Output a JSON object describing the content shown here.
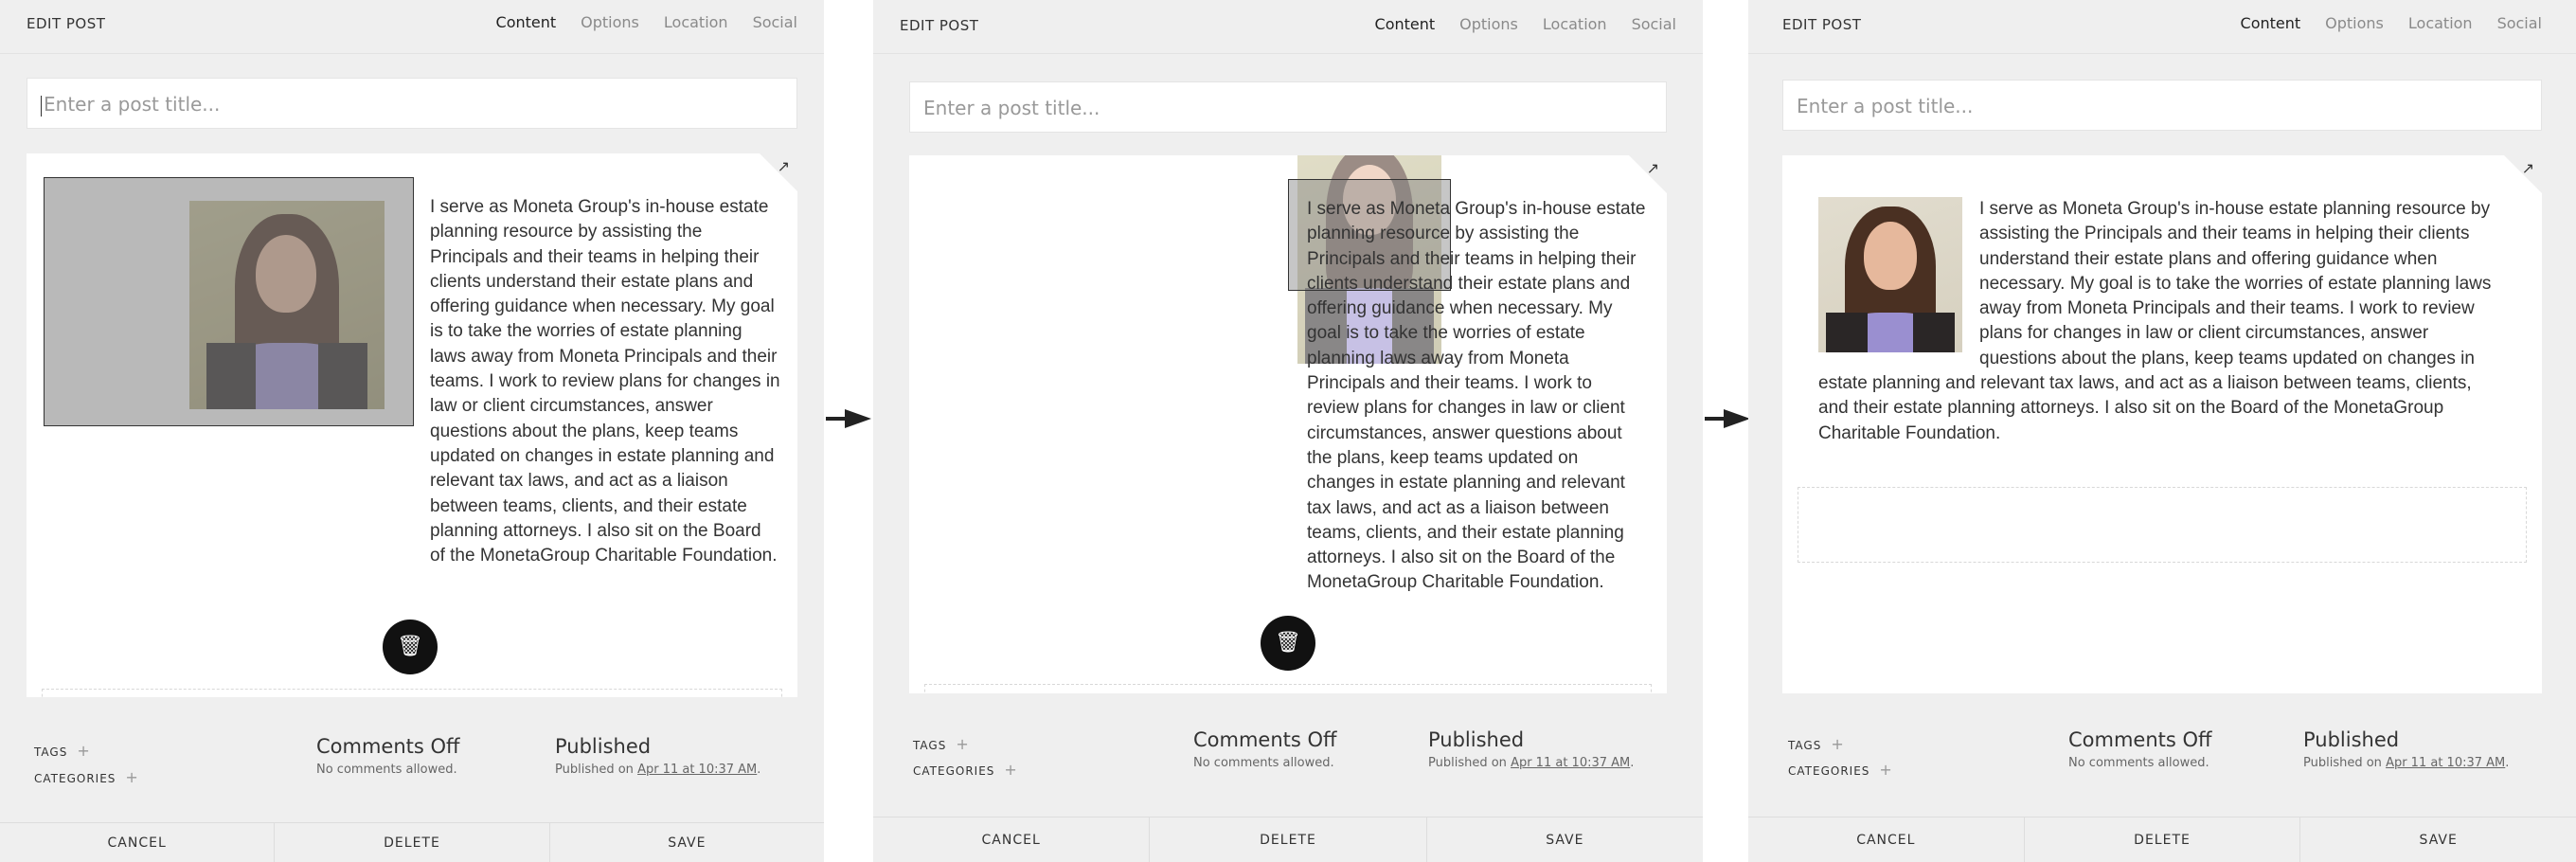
{
  "header": {
    "title": "EDIT POST",
    "tabs": [
      "Content",
      "Options",
      "Location",
      "Social"
    ]
  },
  "post": {
    "title_placeholder": "Enter a post title...",
    "body": "I serve as Moneta Group's in-house estate planning resource by assisting the Principals and their teams in helping their clients understand their estate plans and offering guidance when necessary. My goal is to take the worries of estate planning laws away from Moneta Principals and their teams. I work to review plans for changes in law or client circumstances, answer questions about the plans, keep teams updated on changes in estate planning and relevant tax laws, and act as a liaison between teams, clients, and their estate planning attorneys. I also sit on the Board of the MonetaGroup Charitable Foundation."
  },
  "meta": {
    "tags_label": "TAGS",
    "categories_label": "CATEGORIES",
    "comments_title": "Comments Off",
    "comments_sub": "No comments allowed.",
    "status_title": "Published",
    "status_prefix": "Published on",
    "status_date": "Apr 11 at 10:37 AM",
    "status_suffix": "."
  },
  "footer": {
    "cancel": "CANCEL",
    "delete": "DELETE",
    "save": "SAVE"
  },
  "icons": {
    "expand": "expand-arrow-icon",
    "trash": "trash-icon",
    "plus": "plus-icon",
    "arrow": "right-arrow-icon"
  },
  "glyphs": {
    "expand": "↗",
    "trash": "🗑",
    "plus": "+"
  }
}
